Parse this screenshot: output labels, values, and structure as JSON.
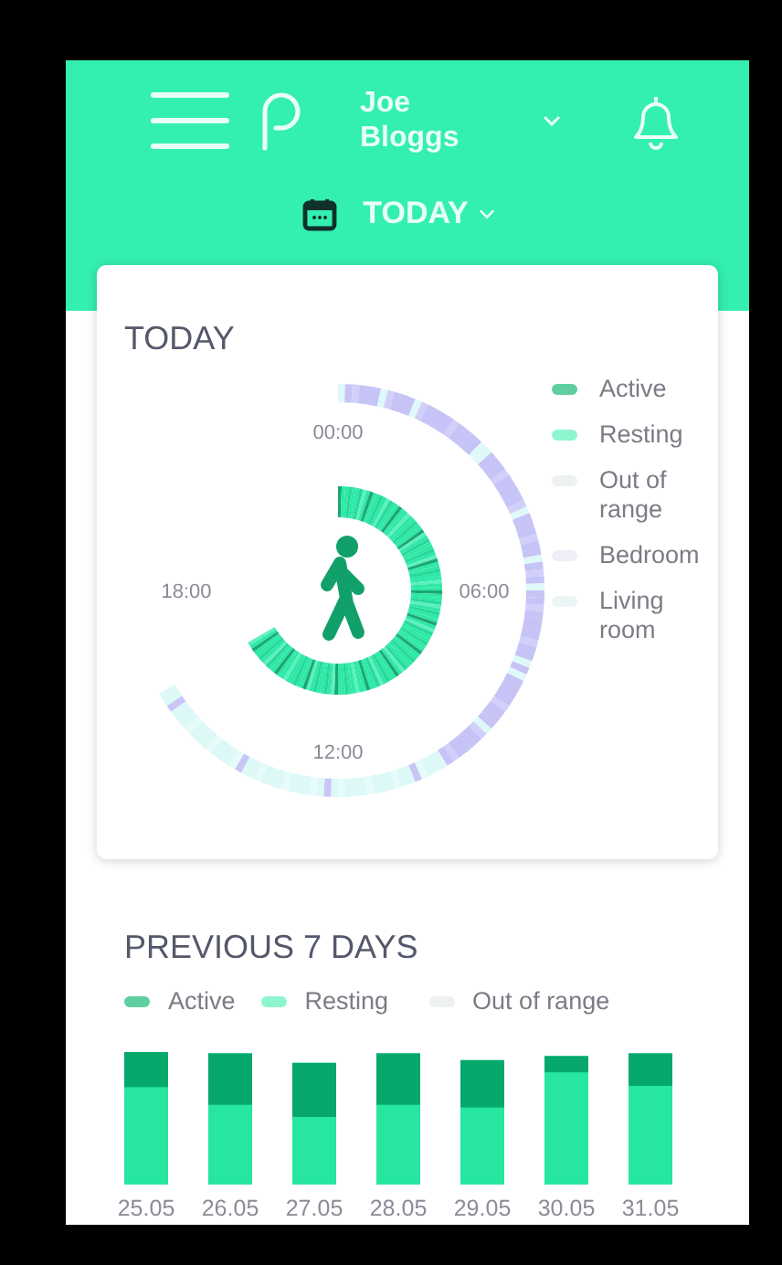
{
  "header": {
    "user_name": "Joe Bloggs",
    "period": "TODAY"
  },
  "today": {
    "title": "TODAY",
    "time_labels": [
      "00:00",
      "06:00",
      "12:00",
      "18:00"
    ],
    "legend": [
      {
        "label": "Active",
        "color": "#5fcf9f"
      },
      {
        "label": "Resting",
        "color": "#8ef5cf"
      },
      {
        "label": "Out of range",
        "color": "#eef1f1"
      },
      {
        "label": "Bedroom",
        "color": "#eeeef8"
      },
      {
        "label": "Living room",
        "color": "#ecf5f5"
      }
    ]
  },
  "previous": {
    "title": "PREVIOUS 7 DAYS",
    "legend": [
      {
        "label": "Active",
        "color": "#5fcf9f"
      },
      {
        "label": "Resting",
        "color": "#8ef5cf"
      },
      {
        "label": "Out of range",
        "color": "#eef1f1"
      }
    ],
    "days": [
      "25.05",
      "26.05",
      "27.05",
      "28.05",
      "29.05",
      "30.05",
      "31.05"
    ]
  }
}
